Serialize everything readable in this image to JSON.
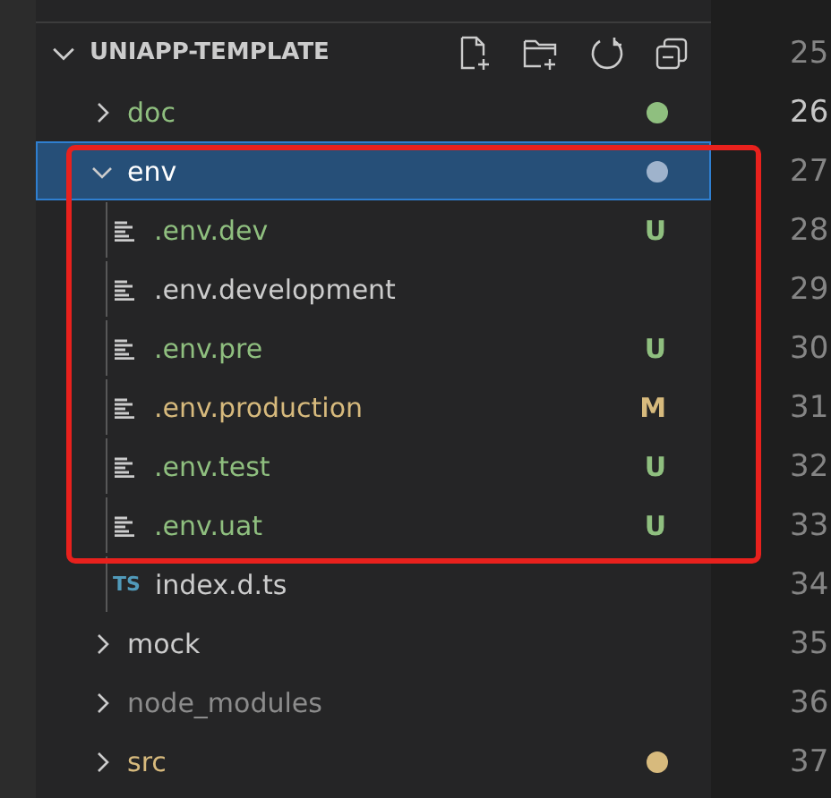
{
  "explorer": {
    "title": "UNIAPP-TEMPLATE",
    "expanded": true,
    "items": [
      {
        "kind": "folder",
        "name": "doc",
        "expanded": false,
        "selected": false,
        "color": "#8fbf7f",
        "dot": true
      },
      {
        "kind": "folder",
        "name": "env",
        "expanded": true,
        "selected": true,
        "color": "#ffffff",
        "dot": true,
        "children": [
          {
            "kind": "env-file",
            "name": ".env.dev",
            "selected": false,
            "color": "#8fbf7f",
            "status": "U"
          },
          {
            "kind": "env-file",
            "name": ".env.development",
            "selected": false,
            "color": "#cccccc"
          },
          {
            "kind": "env-file",
            "name": ".env.pre",
            "selected": false,
            "color": "#8fbf7f",
            "status": "U"
          },
          {
            "kind": "env-file",
            "name": ".env.production",
            "selected": false,
            "color": "#d7ba7d",
            "status": "M"
          },
          {
            "kind": "env-file",
            "name": ".env.test",
            "selected": false,
            "color": "#8fbf7f",
            "status": "U"
          },
          {
            "kind": "env-file",
            "name": ".env.uat",
            "selected": false,
            "color": "#8fbf7f",
            "status": "U"
          },
          {
            "kind": "ts-file",
            "icon_text": "TS",
            "name": "index.d.ts",
            "selected": false,
            "color": "#cccccc"
          }
        ]
      },
      {
        "kind": "folder",
        "name": "mock",
        "expanded": false,
        "selected": false,
        "color": "#cccccc"
      },
      {
        "kind": "folder",
        "name": "node_modules",
        "expanded": false,
        "selected": false,
        "color": "#8c8c8c"
      },
      {
        "kind": "folder",
        "name": "src",
        "expanded": false,
        "selected": false,
        "color": "#d7ba7d",
        "dot": true
      }
    ]
  },
  "line_numbers": [
    {
      "number": "25",
      "active": false
    },
    {
      "number": "26",
      "active": true
    },
    {
      "number": "27",
      "active": false
    },
    {
      "number": "28",
      "active": false
    },
    {
      "number": "29",
      "active": false
    },
    {
      "number": "30",
      "active": false
    },
    {
      "number": "31",
      "active": false
    },
    {
      "number": "32",
      "active": false
    },
    {
      "number": "33",
      "active": false
    },
    {
      "number": "34",
      "active": false
    },
    {
      "number": "35",
      "active": false
    },
    {
      "number": "36",
      "active": false
    },
    {
      "number": "37",
      "active": false
    }
  ],
  "annotation": {
    "kind": "highlight-frame"
  }
}
